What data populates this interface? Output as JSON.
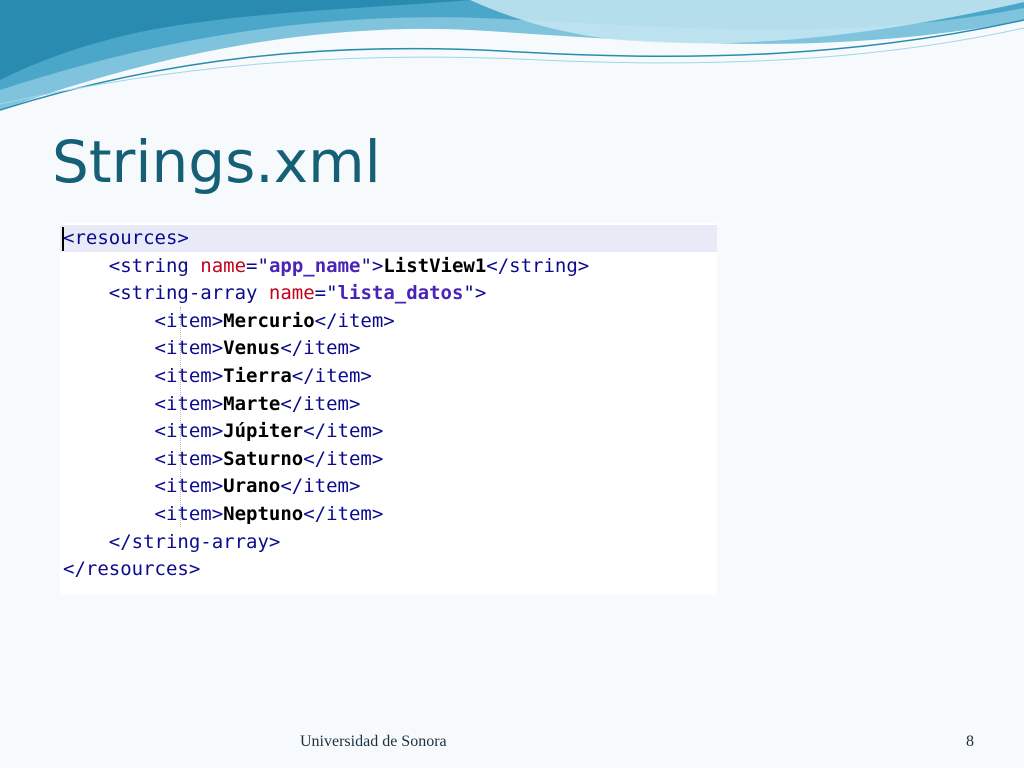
{
  "slide": {
    "title": "Strings.xml",
    "footer": "Universidad de Sonora",
    "page_number": "8"
  },
  "code": {
    "lines": [
      [
        {
          "t": "<resources>",
          "c": "tag"
        }
      ],
      [
        {
          "t": "    <string ",
          "c": "tag"
        },
        {
          "t": "name",
          "c": "attr"
        },
        {
          "t": "=\"",
          "c": "tag"
        },
        {
          "t": "app_name",
          "c": "val"
        },
        {
          "t": "\">",
          "c": "tag"
        },
        {
          "t": "ListView1",
          "c": "txt"
        },
        {
          "t": "</string>",
          "c": "tag"
        }
      ],
      [
        {
          "t": "    <string-array ",
          "c": "tag"
        },
        {
          "t": "name",
          "c": "attr"
        },
        {
          "t": "=\"",
          "c": "tag"
        },
        {
          "t": "lista_datos",
          "c": "val"
        },
        {
          "t": "\">",
          "c": "tag"
        }
      ],
      [
        {
          "t": "        <item>",
          "c": "tag"
        },
        {
          "t": "Mercurio",
          "c": "txt"
        },
        {
          "t": "</item>",
          "c": "tag"
        }
      ],
      [
        {
          "t": "        <item>",
          "c": "tag"
        },
        {
          "t": "Venus",
          "c": "txt"
        },
        {
          "t": "</item>",
          "c": "tag"
        }
      ],
      [
        {
          "t": "        <item>",
          "c": "tag"
        },
        {
          "t": "Tierra",
          "c": "txt"
        },
        {
          "t": "</item>",
          "c": "tag"
        }
      ],
      [
        {
          "t": "        <item>",
          "c": "tag"
        },
        {
          "t": "Marte",
          "c": "txt"
        },
        {
          "t": "</item>",
          "c": "tag"
        }
      ],
      [
        {
          "t": "        <item>",
          "c": "tag"
        },
        {
          "t": "Júpiter",
          "c": "txt"
        },
        {
          "t": "</item>",
          "c": "tag"
        }
      ],
      [
        {
          "t": "        <item>",
          "c": "tag"
        },
        {
          "t": "Saturno",
          "c": "txt"
        },
        {
          "t": "</item>",
          "c": "tag"
        }
      ],
      [
        {
          "t": "        <item>",
          "c": "tag"
        },
        {
          "t": "Urano",
          "c": "txt"
        },
        {
          "t": "</item>",
          "c": "tag"
        }
      ],
      [
        {
          "t": "        <item>",
          "c": "tag"
        },
        {
          "t": "Neptuno",
          "c": "txt"
        },
        {
          "t": "</item>",
          "c": "tag"
        }
      ],
      [
        {
          "t": "    </string-array>",
          "c": "tag"
        }
      ],
      [
        {
          "t": "</resources>",
          "c": "tag"
        }
      ]
    ]
  },
  "colors": {
    "title": "#155f77",
    "wave_dark": "#2a8bb0",
    "wave_light": "#9fd6e8",
    "tag": "#0a0a8c",
    "attribute": "#c4001b",
    "value": "#4a23b8",
    "highlight": "#e8eaf8"
  }
}
